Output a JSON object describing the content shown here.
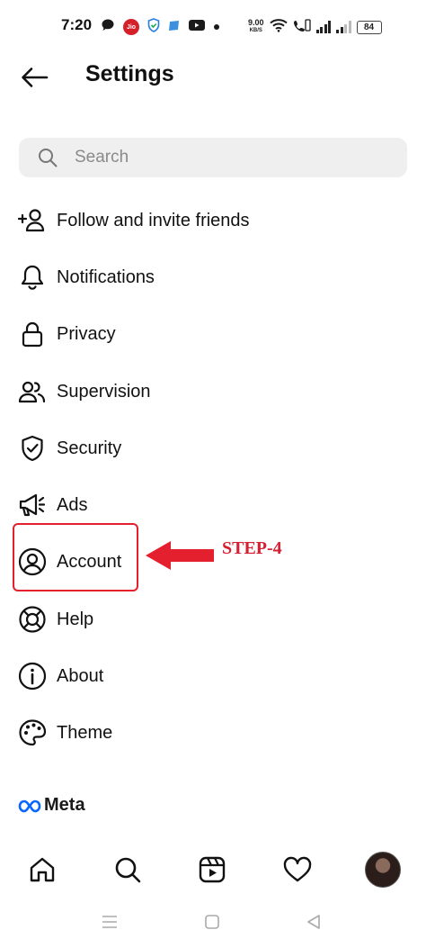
{
  "status_bar": {
    "time": "7:20",
    "jio_badge": "Jio",
    "network_speed": "9.00",
    "network_speed_unit": "KB/S",
    "battery": "84"
  },
  "header": {
    "title": "Settings"
  },
  "search": {
    "placeholder": "Search"
  },
  "menu": {
    "items": [
      {
        "label": "Follow and invite friends",
        "icon": "add-person-icon"
      },
      {
        "label": "Notifications",
        "icon": "bell-icon"
      },
      {
        "label": "Privacy",
        "icon": "lock-icon"
      },
      {
        "label": "Supervision",
        "icon": "people-icon"
      },
      {
        "label": "Security",
        "icon": "shield-icon"
      },
      {
        "label": "Ads",
        "icon": "megaphone-icon"
      },
      {
        "label": "Account",
        "icon": "account-circle-icon"
      },
      {
        "label": "Help",
        "icon": "lifebuoy-icon"
      },
      {
        "label": "About",
        "icon": "info-icon"
      },
      {
        "label": "Theme",
        "icon": "palette-icon"
      }
    ]
  },
  "annotation": {
    "step_label": "STEP-4",
    "color": "#e5202e"
  },
  "footer": {
    "meta_label": "Meta"
  },
  "bottom_nav": {
    "items": [
      "home-icon",
      "search-icon",
      "reels-icon",
      "heart-icon",
      "profile-avatar"
    ]
  },
  "system_nav": {
    "items": [
      "menu-icon",
      "home-square-icon",
      "back-triangle-icon"
    ]
  }
}
